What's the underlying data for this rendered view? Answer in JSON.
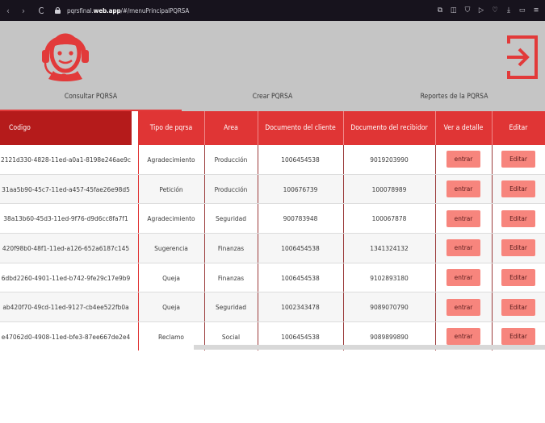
{
  "browser": {
    "url_prefix": "pqrsfinal.",
    "url_domain": "web.app",
    "url_path": "/#/menuPrincipalPQRSA",
    "nav": [
      "‹",
      "›",
      "C"
    ],
    "toolbar_icons": [
      "bookmark-edit-icon",
      "screenshot-icon",
      "shield-icon",
      "play-icon",
      "heart-icon",
      "download-icon",
      "battery-icon",
      "menu-icon"
    ]
  },
  "header": {
    "tabs": [
      {
        "label": "Consultar PQRSA",
        "active": true
      },
      {
        "label": "Crear PQRSA",
        "active": false
      },
      {
        "label": "Reportes de la PQRSA",
        "active": false
      }
    ],
    "accent": "#e23a3a",
    "background": "#c5c5c5"
  },
  "table": {
    "columns": [
      "Codigo",
      "",
      "Tipo de pqrsa",
      "Area",
      "Documento del cliente",
      "Documento del recibidor",
      "Ver a detalle",
      "Editar"
    ],
    "button_labels": {
      "view": "entrar",
      "edit": "Editar"
    },
    "rows": [
      {
        "codigo": "2121d330-4828-11ed-a0a1-8198e246ae9c",
        "tipo": "Agradecimiento",
        "area": "Producción",
        "cliente": "1006454538",
        "recibidor": "9019203990"
      },
      {
        "codigo": "31aa5b90-45c7-11ed-a457-45fae26e98d5",
        "tipo": "Petición",
        "area": "Producción",
        "cliente": "100676739",
        "recibidor": "100078989"
      },
      {
        "codigo": "38a13b60-45d3-11ed-9f76-d9d6cc8fa7f1",
        "tipo": "Agradecimiento",
        "area": "Seguridad",
        "cliente": "900783948",
        "recibidor": "100067878"
      },
      {
        "codigo": "420f98b0-48f1-11ed-a126-652a6187c145",
        "tipo": "Sugerencia",
        "area": "Finanzas",
        "cliente": "1006454538",
        "recibidor": "1341324132"
      },
      {
        "codigo": "6dbd2260-4901-11ed-b742-9fe29c17e9b9",
        "tipo": "Queja",
        "area": "Finanzas",
        "cliente": "1006454538",
        "recibidor": "9102893180"
      },
      {
        "codigo": "ab420f70-49cd-11ed-9127-cb4ee522fb0a",
        "tipo": "Queja",
        "area": "Seguridad",
        "cliente": "1002343478",
        "recibidor": "9089070790"
      },
      {
        "codigo": "e47062d0-4908-11ed-bfe3-87ee667de2e4",
        "tipo": "Reclamo",
        "area": "Social",
        "cliente": "1006454538",
        "recibidor": "9089899890"
      }
    ]
  }
}
